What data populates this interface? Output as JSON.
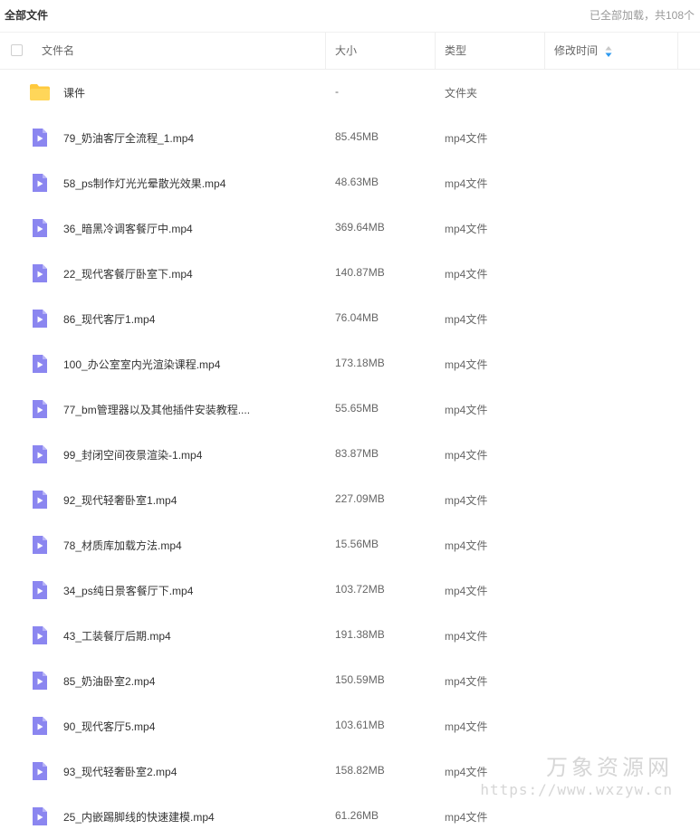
{
  "breadcrumb": "全部文件",
  "summary": "已全部加载，共108个",
  "columns": {
    "name": "文件名",
    "size": "大小",
    "type": "类型",
    "time": "修改时间"
  },
  "files": [
    {
      "icon": "folder-icon",
      "name": "课件",
      "size": "-",
      "type": "文件夹"
    },
    {
      "icon": "video-file-icon",
      "name": "79_奶油客厅全流程_1.mp4",
      "size": "85.45MB",
      "type": "mp4文件"
    },
    {
      "icon": "video-file-icon",
      "name": "58_ps制作灯光光晕散光效果.mp4",
      "size": "48.63MB",
      "type": "mp4文件"
    },
    {
      "icon": "video-file-icon",
      "name": "36_暗黑冷调客餐厅中.mp4",
      "size": "369.64MB",
      "type": "mp4文件"
    },
    {
      "icon": "video-file-icon",
      "name": "22_现代客餐厅卧室下.mp4",
      "size": "140.87MB",
      "type": "mp4文件"
    },
    {
      "icon": "video-file-icon",
      "name": "86_现代客厅1.mp4",
      "size": "76.04MB",
      "type": "mp4文件"
    },
    {
      "icon": "video-file-icon",
      "name": "100_办公室室内光渲染课程.mp4",
      "size": "173.18MB",
      "type": "mp4文件"
    },
    {
      "icon": "video-file-icon",
      "name": "77_bm管理器以及其他插件安装教程....",
      "size": "55.65MB",
      "type": "mp4文件"
    },
    {
      "icon": "video-file-icon",
      "name": "99_封闭空间夜景渲染-1.mp4",
      "size": "83.87MB",
      "type": "mp4文件"
    },
    {
      "icon": "video-file-icon",
      "name": "92_现代轻奢卧室1.mp4",
      "size": "227.09MB",
      "type": "mp4文件"
    },
    {
      "icon": "video-file-icon",
      "name": "78_材质库加载方法.mp4",
      "size": "15.56MB",
      "type": "mp4文件"
    },
    {
      "icon": "video-file-icon",
      "name": "34_ps纯日景客餐厅下.mp4",
      "size": "103.72MB",
      "type": "mp4文件"
    },
    {
      "icon": "video-file-icon",
      "name": "43_工装餐厅后期.mp4",
      "size": "191.38MB",
      "type": "mp4文件"
    },
    {
      "icon": "video-file-icon",
      "name": "85_奶油卧室2.mp4",
      "size": "150.59MB",
      "type": "mp4文件"
    },
    {
      "icon": "video-file-icon",
      "name": "90_现代客厅5.mp4",
      "size": "103.61MB",
      "type": "mp4文件"
    },
    {
      "icon": "video-file-icon",
      "name": "93_现代轻奢卧室2.mp4",
      "size": "158.82MB",
      "type": "mp4文件"
    },
    {
      "icon": "video-file-icon",
      "name": "25_内嵌踢脚线的快速建模.mp4",
      "size": "61.26MB",
      "type": "mp4文件"
    }
  ],
  "watermark": {
    "title": "万象资源网",
    "url": "https://www.wxzyw.cn"
  },
  "colors": {
    "folder": "#FFC93D",
    "video": "#8B86F0",
    "sort_active": "#2E9AEF",
    "sort_inactive": "#C8C8C8"
  }
}
